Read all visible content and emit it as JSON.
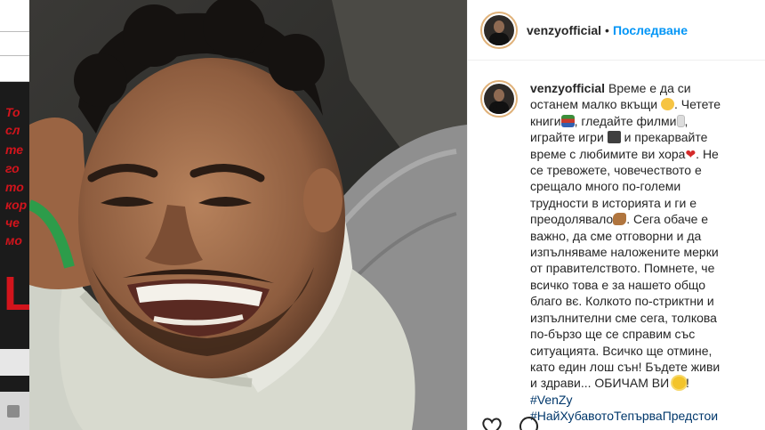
{
  "background_page": {
    "red_text_lines": [
      "То",
      "сл",
      "те",
      "го",
      "то",
      "кор",
      "че",
      "мо"
    ]
  },
  "post": {
    "username": "venzyofficial",
    "separator": "•",
    "follow_label": "Последване"
  },
  "caption": {
    "username": "venzyofficial",
    "seg1": "Време е да си останем малко вкъщи ",
    "seg2": ". Четете книги",
    "seg3": ", гледайте филми",
    "seg4": ", играйте игри ",
    "seg5": " и прекарвайте време с любимите ви хора",
    "seg6": ". Не се тревожете, човечеството е срещало много по-големи трудности в историята и ги е преодолявало",
    "seg7": ". Сега обаче е важно, да сме отговорни и да изпълняваме наложените мерки от правителството. Помнете, че всичко това е за нашето общо благо вє. Колкото по-стриктни и изпълнителни сме сега, толкова по-бързо ще се справим със ситуацията. Всичко ще отмине, като един лош сън! Бъдете живи и здрави... ОБИЧАМ ВИ ",
    "seg8": "! ",
    "hashtag1": "#VenZy",
    "hashtag2": "#НайХубавотоТепърваПредстои"
  },
  "icons": {
    "grin": "grinning-face-emoji",
    "books": "books-emoji",
    "film": "film-emoji",
    "laptop": "laptop-emoji",
    "heart": "heart-emoji",
    "muscle": "flexed-biceps-emoji",
    "sun": "sun-emoji",
    "like": "heart-outline-icon",
    "comment": "comment-icon"
  },
  "colors": {
    "follow_blue": "#0095f6",
    "hashtag_blue": "#00376b",
    "text": "#262626",
    "red": "#d2141c"
  }
}
